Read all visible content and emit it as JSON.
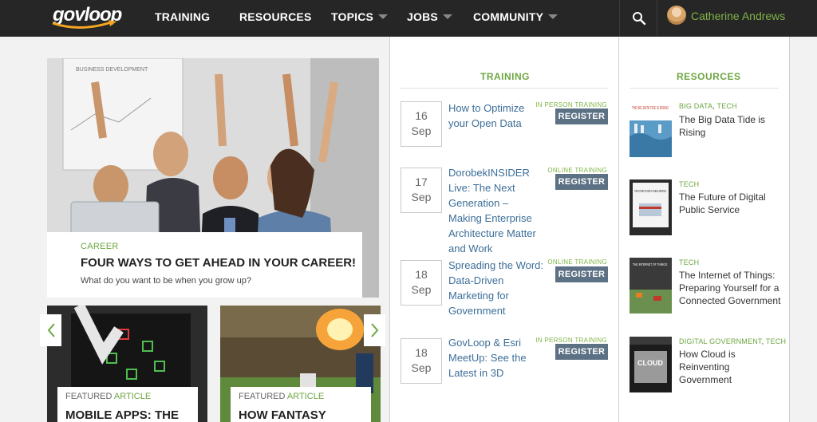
{
  "nav": {
    "logo_text": "govloop",
    "items": [
      {
        "label": "TRAINING",
        "dropdown": false
      },
      {
        "label": "RESOURCES",
        "dropdown": false
      },
      {
        "label": "TOPICS",
        "dropdown": true
      },
      {
        "label": "JOBS",
        "dropdown": true
      },
      {
        "label": "COMMUNITY",
        "dropdown": true
      }
    ],
    "search_icon": "search-icon",
    "user_name": "Catherine Andrews"
  },
  "colors": {
    "nav_bg": "#262626",
    "accent_green": "#6ea642",
    "link_blue": "#3c6e99",
    "button_slate": "#5c7184"
  },
  "featured": {
    "category": "CAREER",
    "title": "FOUR WAYS TO GET AHEAD IN YOUR CAREER!",
    "subtitle": "What do you want to be when you grow up?",
    "whiteboard_text": "BUSINESS DEVELOPMENT"
  },
  "cards": [
    {
      "label_prefix": "FEATURED",
      "label_suffix": "ARTICLE",
      "title": "MOBILE APPS: THE"
    },
    {
      "label_prefix": "FEATURED",
      "label_suffix": "ARTICLE",
      "title": "HOW FANTASY"
    }
  ],
  "training": {
    "heading": "TRAINING",
    "items": [
      {
        "day": "16",
        "month": "Sep",
        "title": "How to Optimize your Open Data",
        "type": "IN PERSON TRAINING",
        "button": "REGISTER"
      },
      {
        "day": "17",
        "month": "Sep",
        "title": "DorobekINSIDER Live: The Next Generation – Making Enterprise Architecture Matter and Work",
        "type": "ONLINE TRAINING",
        "button": "REGISTER"
      },
      {
        "day": "18",
        "month": "Sep",
        "title": "Spreading the Word: Data-Driven Marketing for Government",
        "type": "ONLINE TRAINING",
        "button": "REGISTER"
      },
      {
        "day": "18",
        "month": "Sep",
        "title": "GovLoop & Esri MeetUp: See the Latest in 3D",
        "type": "IN PERSON TRAINING",
        "button": "REGISTER"
      }
    ]
  },
  "resources": {
    "heading": "RESOURCES",
    "items": [
      {
        "tags": [
          "BIG DATA",
          "TECH"
        ],
        "title": "The Big Data Tide is Rising",
        "thumb_text": "THE BIG DATA TIDE IS RISING"
      },
      {
        "tags": [
          "TECH"
        ],
        "title": "The Future of Digital Public Service",
        "thumb_text": "THE FUTURE OF DIGITAL PUBLIC SERVICES"
      },
      {
        "tags": [
          "TECH"
        ],
        "title": "The Internet of Things: Preparing Yourself for a Connected Government",
        "thumb_text": "THE INTERNET OF THINGS:"
      },
      {
        "tags": [
          "DIGITAL GOVERNMENT",
          "TECH"
        ],
        "title": "How Cloud is Reinventing Government",
        "thumb_text": "CLOUD"
      }
    ]
  }
}
